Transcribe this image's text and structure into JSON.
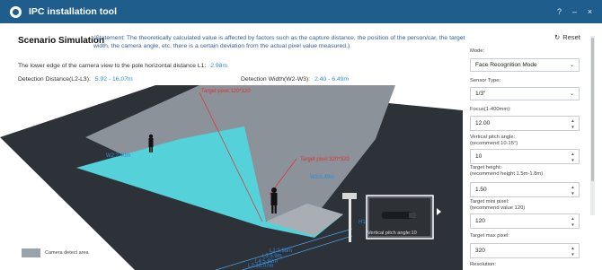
{
  "window": {
    "title": "IPC installation tool",
    "controls": [
      "?",
      "–",
      "×"
    ]
  },
  "header": {
    "title": "Scenario Simulation",
    "statement": "(Statement: The theoretically calculated value is affected by factors such as the capture distance, the position of the person/car, the target width, the camera angle, etc. there is a certain deviation from the actual pixel value measured.)",
    "reset_label": "Reset"
  },
  "info": {
    "lower_edge_label": "The lower edge of the camera view to the pole horizontal distance L1:",
    "lower_edge_value": "2.98m",
    "distance_label": "Detection Distance(L2-L3):",
    "distance_value": "5.92 - 16.07m",
    "width_label": "Detection Width(W2-W3):",
    "width_value": "2.40 - 6.49m"
  },
  "scene": {
    "target_pixel_far": "Target pixel:120*120",
    "target_pixel_near": "Target pixel:320*320",
    "height_label": "H1",
    "legend_label": "Camera detect area",
    "device_label": "Vertical pitch angle:10",
    "dist_labels": [
      "L1:2.98m",
      "L3:5.9m",
      "L4:5.92m",
      "L2:16.07m"
    ],
    "w_labels": [
      "W2:2.40m",
      "W3:6.49m"
    ]
  },
  "panel": {
    "mode_label": "Mode:",
    "mode_value": "Face Recognition Mode",
    "sensor_label": "Sensor Type:",
    "sensor_value": "1/3\"",
    "focus_label": "Focus(1-400mm):",
    "focus_value": "12.00",
    "pitch_label": "Vertical pitch angle:\n(recommend 10-15°)",
    "pitch_value": "10",
    "height_label": "Target height:\n(recommend height 1.5m-1.8m)",
    "height_value": "1.50",
    "min_pixel_label": "Target mini pixel:\n(recommend value 120)",
    "min_pixel_value": "120",
    "max_pixel_label": "Target max pixel:",
    "max_pixel_value": "320",
    "resolution_label": "Resolution:"
  },
  "colors": {
    "titlebar": "#1f5e8c",
    "accent_blue": "#3a8ed9",
    "detect_area": "#4fd0d8",
    "floor": "#2b2f36",
    "red_line": "#e03030"
  }
}
